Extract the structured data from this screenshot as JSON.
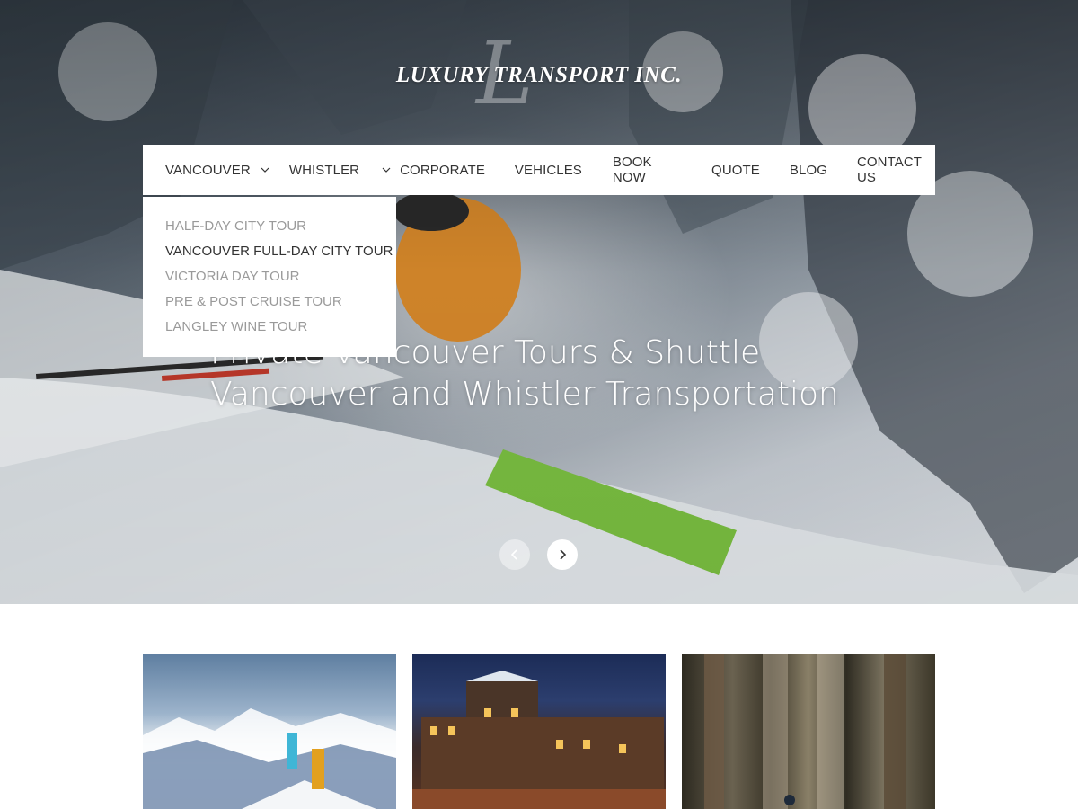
{
  "brand": {
    "monogram": "L",
    "name": "LUXURY TRANSPORT INC."
  },
  "nav": {
    "items": [
      {
        "label": "VANCOUVER"
      },
      {
        "label": "WHISTLER"
      },
      {
        "label": "CORPORATE"
      },
      {
        "label": "VEHICLES"
      },
      {
        "label": "BOOK NOW"
      },
      {
        "label": "QUOTE"
      },
      {
        "label": "BLOG"
      },
      {
        "label": "CONTACT US"
      }
    ]
  },
  "dropdown": {
    "items": [
      {
        "label": "HALF-DAY CITY TOUR",
        "active": false
      },
      {
        "label": "VANCOUVER FULL-DAY CITY TOUR",
        "active": true
      },
      {
        "label": "VICTORIA DAY TOUR",
        "active": false
      },
      {
        "label": "PRE & POST CRUISE TOUR",
        "active": false
      },
      {
        "label": "LANGLEY WINE TOUR",
        "active": false
      }
    ]
  },
  "hero": {
    "line1": "Private Vancouver Tours & Shuttle",
    "line2": "Vancouver and Whistler Transportation"
  },
  "slider": {
    "prev_icon": "chevron-left-icon",
    "next_icon": "chevron-right-icon"
  },
  "colors": {
    "nav_text": "#333333",
    "dropdown_inactive": "#9a9a9a",
    "dropdown_active": "#333333"
  }
}
